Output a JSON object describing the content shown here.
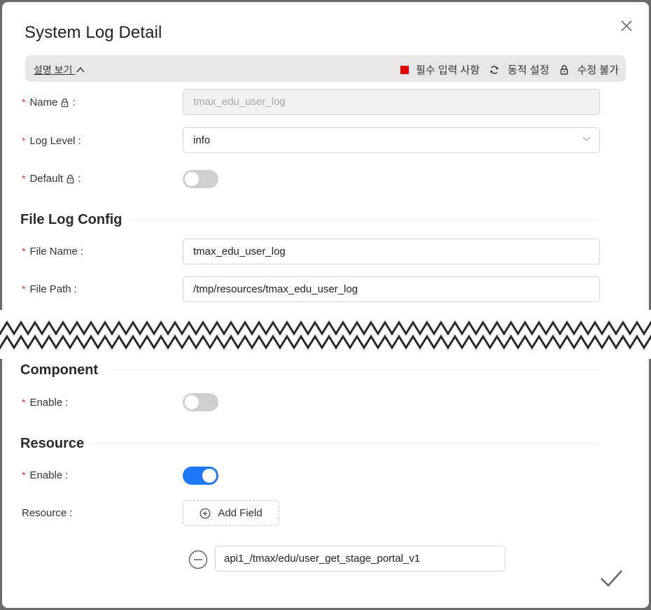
{
  "dialog": {
    "title": "System Log Detail"
  },
  "info_bar": {
    "toggle_label": "설명 보기",
    "legend_required": "필수 입력 사항",
    "legend_dynamic": "동적 설정",
    "legend_readonly": "수정 불가",
    "required_color": "#e00000"
  },
  "form": {
    "name_label": "Name",
    "name_value": "tmax_edu_user_log",
    "log_level_label": "Log Level",
    "log_level_value": "info",
    "default_label": "Default",
    "default_enabled": false,
    "file_section_title": "File Log Config",
    "file_name_label": "File Name",
    "file_name_value": "tmax_edu_user_log",
    "file_path_label": "File Path",
    "file_path_value": "/tmp/resources/tmax_edu_user_log",
    "component_section_title": "Component",
    "component_enable_label": "Enable",
    "component_enabled": false,
    "resource_section_title": "Resource",
    "resource_enable_label": "Enable",
    "resource_enabled": true,
    "resource_label": "Resource",
    "add_field_label": "Add Field",
    "resource_item_value": "api1_/tmax/edu/user_get_stage_portal_v1"
  },
  "colors": {
    "accent": "#1e77f5",
    "required_star": "#e53935"
  },
  "icons": [
    "close-icon",
    "chevron-up-icon",
    "refresh-icon",
    "lock-icon",
    "chevron-down-icon",
    "plus-circle-icon",
    "minus-circle-icon",
    "check-icon"
  ],
  "separators": {
    "colon": ":",
    "required_star": "*"
  }
}
